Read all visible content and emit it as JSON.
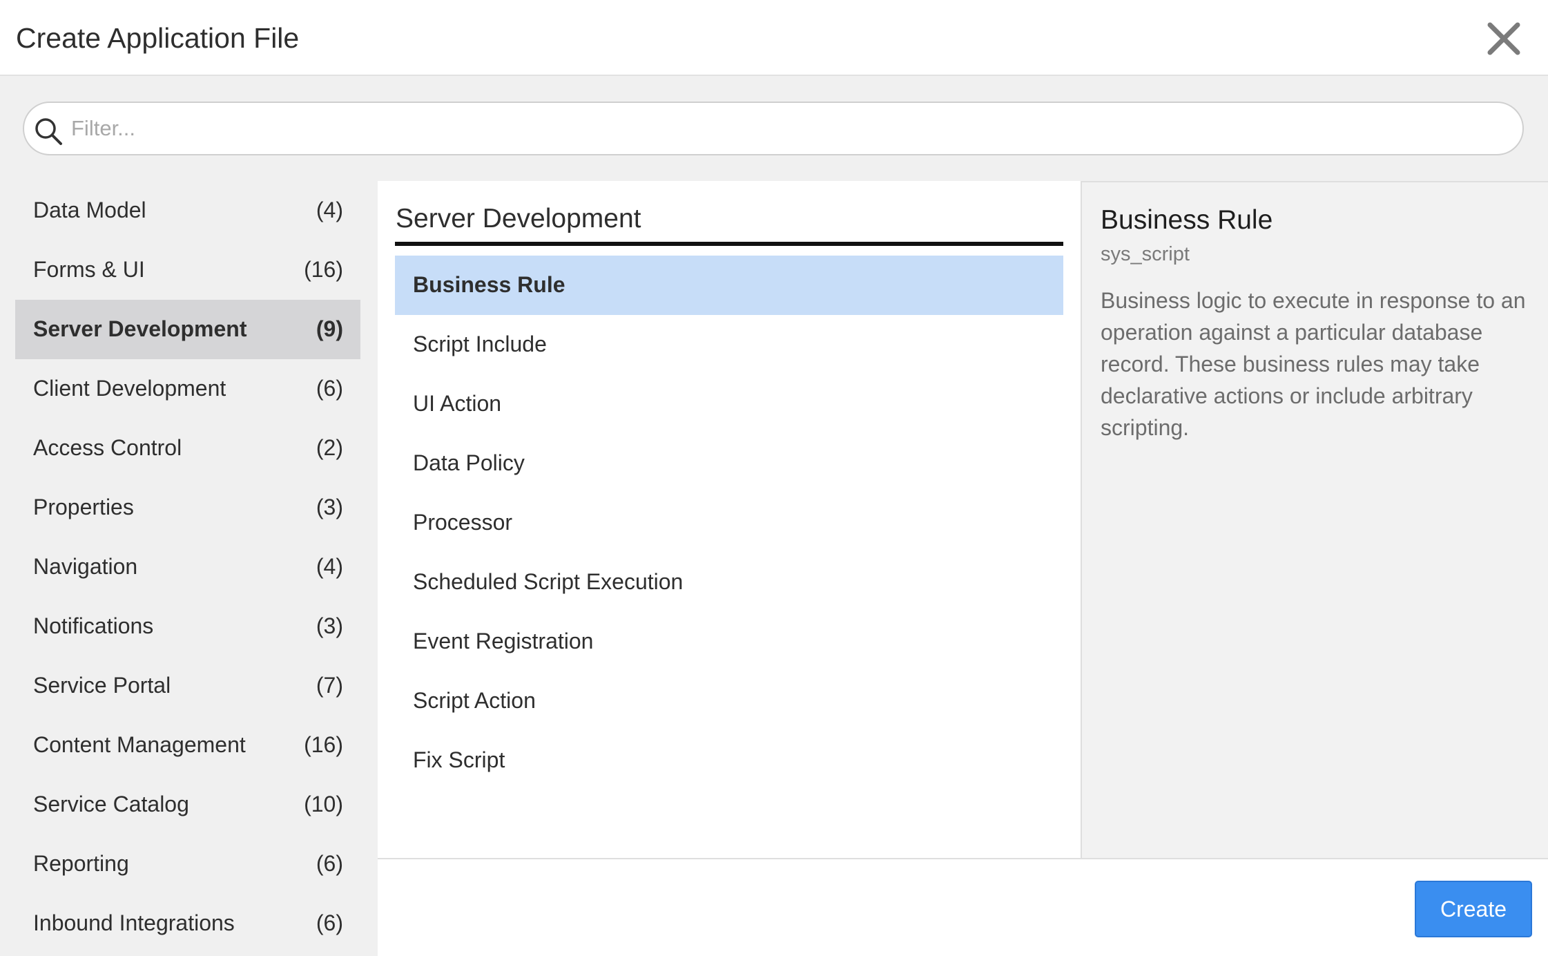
{
  "dialog": {
    "title": "Create Application File",
    "close_icon": "close-icon"
  },
  "filter": {
    "placeholder": "Filter...",
    "value": "",
    "icon": "search-icon"
  },
  "categories": [
    {
      "label": "Data Model",
      "count": "(4)"
    },
    {
      "label": "Forms & UI",
      "count": "(16)"
    },
    {
      "label": "Server Development",
      "count": "(9)",
      "selected": true
    },
    {
      "label": "Client Development",
      "count": "(6)"
    },
    {
      "label": "Access Control",
      "count": "(2)"
    },
    {
      "label": "Properties",
      "count": "(3)"
    },
    {
      "label": "Navigation",
      "count": "(4)"
    },
    {
      "label": "Notifications",
      "count": "(3)"
    },
    {
      "label": "Service Portal",
      "count": "(7)"
    },
    {
      "label": "Content Management",
      "count": "(16)"
    },
    {
      "label": "Service Catalog",
      "count": "(10)"
    },
    {
      "label": "Reporting",
      "count": "(6)"
    },
    {
      "label": "Inbound Integrations",
      "count": "(6)"
    }
  ],
  "middle": {
    "title": "Server Development",
    "items": [
      {
        "label": "Business Rule",
        "selected": true
      },
      {
        "label": "Script Include"
      },
      {
        "label": "UI Action"
      },
      {
        "label": "Data Policy"
      },
      {
        "label": "Processor"
      },
      {
        "label": "Scheduled Script Execution"
      },
      {
        "label": "Event Registration"
      },
      {
        "label": "Script Action"
      },
      {
        "label": "Fix Script"
      }
    ]
  },
  "detail": {
    "title": "Business Rule",
    "table": "sys_script",
    "description": "Business logic to execute in response to an operation against a particular database record. These business rules may take declarative actions or include arbitrary scripting."
  },
  "footer": {
    "create_label": "Create"
  },
  "colors": {
    "selected_category_bg": "#d5d5d7",
    "selected_item_bg": "#c7ddf8",
    "primary_button": "#3a8ef0"
  }
}
